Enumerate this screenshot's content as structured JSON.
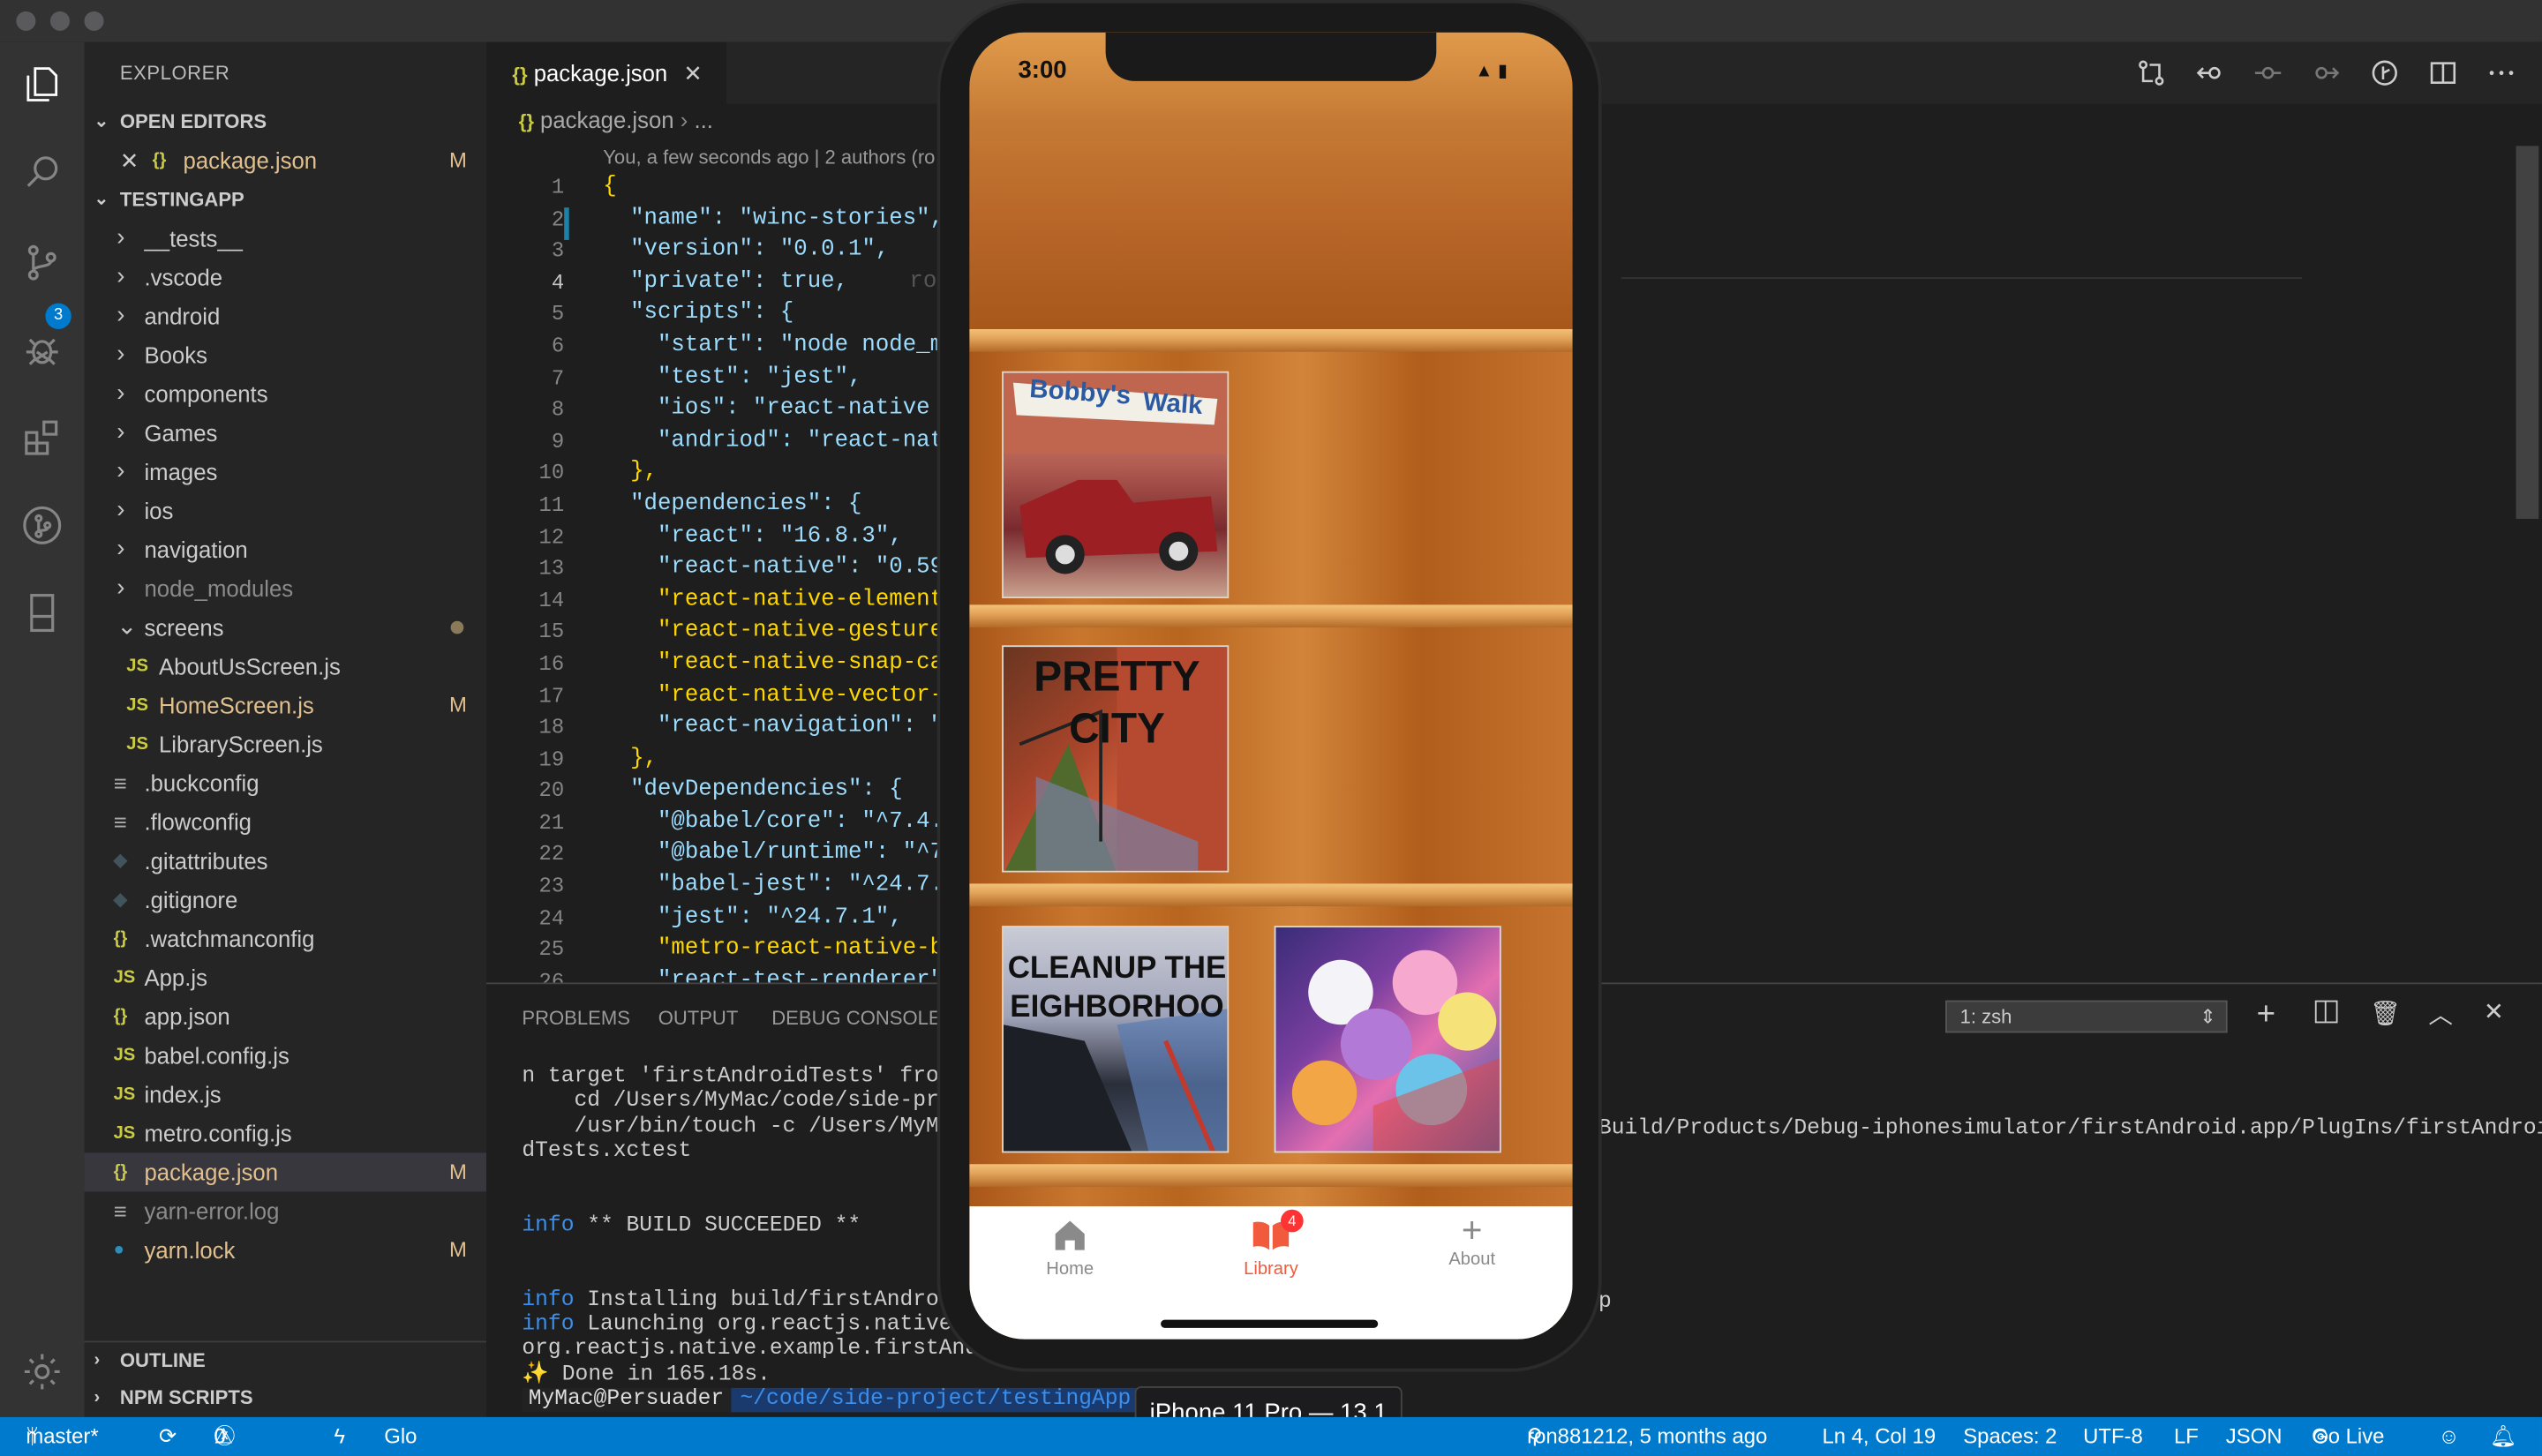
{
  "window": {
    "controls": [
      "close",
      "minimize",
      "maximize"
    ]
  },
  "activity_bar": {
    "icons": [
      "files-icon",
      "search-icon",
      "source-control-icon",
      "debug-icon",
      "extensions-icon",
      "git-graph-icon",
      "device-icon",
      "gear-icon"
    ],
    "scm_badge": "3"
  },
  "explorer": {
    "title": "EXPLORER",
    "open_editors": {
      "label": "OPEN EDITORS",
      "files": [
        {
          "name": "package.json",
          "icon": "{}",
          "status": "M"
        }
      ]
    },
    "project": {
      "label": "TESTINGAPP",
      "items": [
        {
          "name": "__tests__",
          "type": "folder"
        },
        {
          "name": ".vscode",
          "type": "folder"
        },
        {
          "name": "android",
          "type": "folder"
        },
        {
          "name": "Books",
          "type": "folder"
        },
        {
          "name": "components",
          "type": "folder"
        },
        {
          "name": "Games",
          "type": "folder"
        },
        {
          "name": "images",
          "type": "folder"
        },
        {
          "name": "ios",
          "type": "folder"
        },
        {
          "name": "navigation",
          "type": "folder"
        },
        {
          "name": "node_modules",
          "type": "folder"
        },
        {
          "name": "screens",
          "type": "folder-open"
        },
        {
          "name": "AboutUsScreen.js",
          "type": "js"
        },
        {
          "name": "HomeScreen.js",
          "type": "js",
          "status": "M"
        },
        {
          "name": "LibraryScreen.js",
          "type": "js"
        },
        {
          "name": ".buckconfig",
          "type": "text"
        },
        {
          "name": ".flowconfig",
          "type": "text"
        },
        {
          "name": ".gitattributes",
          "type": "git"
        },
        {
          "name": ".gitignore",
          "type": "git"
        },
        {
          "name": ".watchmanconfig",
          "type": "json"
        },
        {
          "name": "App.js",
          "type": "js"
        },
        {
          "name": "app.json",
          "type": "json"
        },
        {
          "name": "babel.config.js",
          "type": "js"
        },
        {
          "name": "index.js",
          "type": "js"
        },
        {
          "name": "metro.config.js",
          "type": "js"
        },
        {
          "name": "package.json",
          "type": "json",
          "status": "M"
        },
        {
          "name": "yarn-error.log",
          "type": "text"
        },
        {
          "name": "yarn.lock",
          "type": "yarn",
          "status": "M"
        }
      ]
    },
    "outline": "OUTLINE",
    "npm_scripts": "NPM SCRIPTS"
  },
  "editor": {
    "tab_label": "package.json",
    "breadcrumb": "package.json",
    "breadcrumb_more": "...",
    "blame": "You, a few seconds ago | 2 authors (ro",
    "line_numbers": [
      "1",
      "2",
      "3",
      "4",
      "5",
      "6",
      "7",
      "8",
      "9",
      "10",
      "11",
      "12",
      "13",
      "14",
      "15",
      "16",
      "17",
      "18",
      "19",
      "20",
      "21",
      "22",
      "23",
      "24",
      "25",
      "26"
    ],
    "lines": [
      "{",
      "  \"name\": \"winc-stories\",",
      "  \"version\": \"0.0.1\",",
      "  \"private\": true,",
      "  \"scripts\": {",
      "    \"start\": \"node node_mo",
      "    \"test\": \"jest\",",
      "    \"ios\": \"react-native r",
      "    \"andriod\": \"react-nati",
      "  },",
      "  \"dependencies\": {",
      "    \"react\": \"16.8.3\",",
      "    \"react-native\": \"0.59.",
      "    \"react-native-elements",
      "    \"react-native-gesture-",
      "    \"react-native-snap-car",
      "    \"react-native-vector-i",
      "    \"react-navigation\": \"^",
      "  },",
      "  \"devDependencies\": {",
      "    \"@babel/core\": \"^7.4.4",
      "    \"@babel/runtime\": \"^7.4",
      "    \"babel-jest\": \"^24.7.1",
      "    \"jest\": \"^24.7.1\",",
      "    \"metro-react-native-ba",
      "    \"react-test-renderer\":"
    ],
    "inline_hint": "ro"
  },
  "panel": {
    "tabs": [
      "PROBLEMS",
      "OUTPUT",
      "DEBUG CONSOLE"
    ],
    "terminal_select": "1: zsh",
    "terminal_lines": [
      "n target 'firstAndroidTests' from",
      "    cd /Users/MyMac/code/side-proj",
      "    /usr/bin/touch -c /Users/MyMa",
      "dTests.xctest",
      "",
      "",
      "info ** BUILD SUCCEEDED **",
      "",
      "",
      "info Installing build/firstAndroid",
      "info Launching org.reactjs.native.e",
      "org.reactjs.native.example.firstAndro",
      "✨ Done in 165.18s."
    ],
    "terminal_right": "Build/Products/Debug-iphonesimulator/firstAndroid.app/PlugIns/firstAndroi",
    "terminal_right2": "p",
    "prompt_user": "MyMac@Persuader",
    "prompt_path": "~/code/side-project/testingApp"
  },
  "simulator": {
    "device_label": "iPhone 11 Pro — 13.1",
    "clock": "3:00",
    "books": [
      {
        "title_line1": "Bobby's",
        "title_line2": "Walk"
      },
      {
        "title_line1": "PRETTY",
        "title_line2": "CITY"
      },
      {
        "title_line1": "CLEANUP THE",
        "title_line2": "EIGHBORHOO"
      },
      {
        "title_line1": "",
        "title_line2": ""
      }
    ],
    "tabs": [
      {
        "label": "Home",
        "icon": "home-icon"
      },
      {
        "label": "Library",
        "icon": "book-open-icon",
        "badge": "4"
      },
      {
        "label": "About",
        "icon": "plus-icon"
      }
    ],
    "accent": "#f15a3c"
  },
  "status_bar": {
    "branch": "master*",
    "errors": "0",
    "warnings": "0",
    "live_share": "Glo",
    "blame": "ron881212, 5 months ago",
    "position": "Ln 4, Col 19",
    "spaces": "Spaces: 2",
    "encoding": "UTF-8",
    "eol": "LF",
    "language": "JSON",
    "go_live": "Go Live"
  }
}
